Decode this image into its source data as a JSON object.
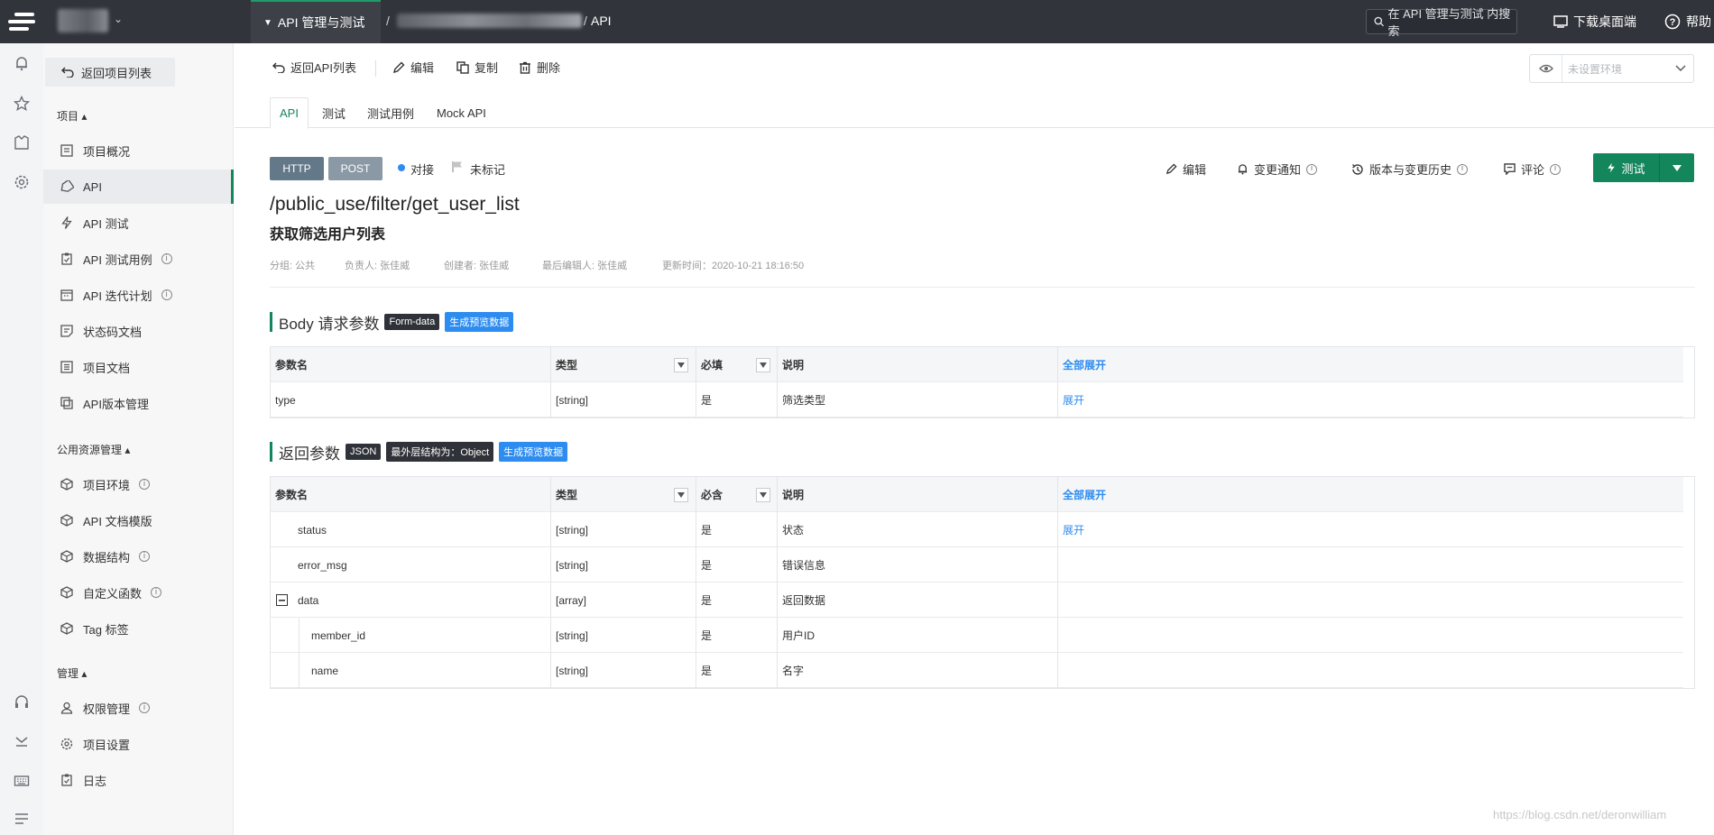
{
  "topbar": {
    "module_label": "API 管理与测试",
    "crumb_sep": "/",
    "crumb_api": "API",
    "search_placeholder": "在 API 管理与测试 内搜索",
    "download_label": "下载桌面端",
    "help_label": "帮助"
  },
  "sidenav": {
    "back_label": "返回项目列表",
    "group_project": "项目",
    "group_public": "公用资源管理",
    "group_manage": "管理",
    "items": [
      {
        "label": "项目概况",
        "icon": "overview-icon"
      },
      {
        "label": "API",
        "icon": "api-tag-icon"
      },
      {
        "label": "API 测试",
        "icon": "lightning-icon"
      },
      {
        "label": "API 测试用例",
        "icon": "testcase-icon"
      },
      {
        "label": "API 迭代计划",
        "icon": "plan-icon"
      },
      {
        "label": "状态码文档",
        "icon": "statuscode-icon"
      },
      {
        "label": "项目文档",
        "icon": "doc-icon"
      },
      {
        "label": "API版本管理",
        "icon": "version-icon"
      },
      {
        "label": "项目环境",
        "icon": "cube-icon"
      },
      {
        "label": "API 文档模版",
        "icon": "cube-icon"
      },
      {
        "label": "数据结构",
        "icon": "cube-icon"
      },
      {
        "label": "自定义函数",
        "icon": "cube-icon"
      },
      {
        "label": "Tag 标签",
        "icon": "cube-icon"
      },
      {
        "label": "权限管理",
        "icon": "user-icon"
      },
      {
        "label": "项目设置",
        "icon": "gear-icon"
      },
      {
        "label": "日志",
        "icon": "log-icon"
      }
    ]
  },
  "toolbar": {
    "back_label": "返回API列表",
    "edit_label": "编辑",
    "copy_label": "复制",
    "delete_label": "删除",
    "env_placeholder": "未设置环境"
  },
  "tabs": [
    "API",
    "测试",
    "测试用例",
    "Mock API"
  ],
  "api": {
    "protocol": "HTTP",
    "method": "POST",
    "status": "对接",
    "mark": "未标记",
    "path": "/public_use/filter/get_user_list",
    "name": "获取筛选用户列表",
    "meta": {
      "group": "分组: 公共",
      "owner": "负责人: 张佳威",
      "creator": "创建者: 张佳威",
      "last_editor": "最后编辑人: 张佳威",
      "updated": "更新时间：2020-10-21 18:16:50"
    },
    "actions": {
      "edit": "编辑",
      "notify": "变更通知",
      "history": "版本与变更历史",
      "comment": "评论",
      "test": "测试"
    }
  },
  "body_params": {
    "title": "Body 请求参数",
    "tag_format": "Form-data",
    "tag_preview": "生成预览数据",
    "headers": {
      "name": "参数名",
      "type": "类型",
      "required": "必填",
      "desc": "说明",
      "expand_all": "全部展开"
    },
    "rows": [
      {
        "name": "type",
        "type": "[string]",
        "required": "是",
        "desc": "筛选类型",
        "link": "展开"
      }
    ]
  },
  "return_params": {
    "title": "返回参数",
    "tag_format": "JSON",
    "tag_outer": "最外层结构为：Object",
    "tag_preview": "生成预览数据",
    "headers": {
      "name": "参数名",
      "type": "类型",
      "required": "必含",
      "desc": "说明",
      "expand_all": "全部展开"
    },
    "rows": [
      {
        "name": "status",
        "type": "[string]",
        "required": "是",
        "desc": "状态",
        "link": "展开"
      },
      {
        "name": "error_msg",
        "type": "[string]",
        "required": "是",
        "desc": "错误信息",
        "link": ""
      },
      {
        "name": "data",
        "type": "[array]",
        "required": "是",
        "desc": "返回数据",
        "link": ""
      },
      {
        "name": "member_id",
        "type": "[string]",
        "required": "是",
        "desc": "用户ID",
        "link": ""
      },
      {
        "name": "name",
        "type": "[string]",
        "required": "是",
        "desc": "名字",
        "link": ""
      }
    ]
  },
  "watermark": "https://blog.csdn.net/deronwilliam",
  "colors": {
    "accent": "#13865c",
    "link": "#2d8cf0",
    "topbar": "#31343b"
  }
}
